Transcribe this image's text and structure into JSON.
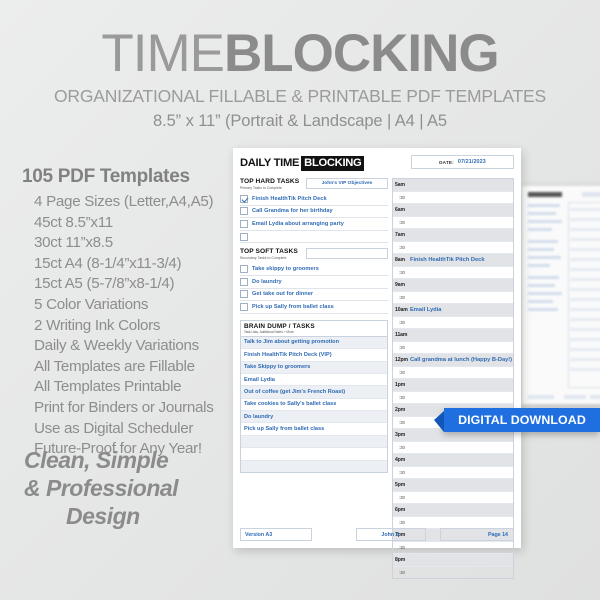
{
  "header": {
    "title_light": "TIME",
    "title_bold": "BLOCKING",
    "subtitle": "ORGANIZATIONAL FILLABLE & PRINTABLE PDF TEMPLATES",
    "subtitle2": "8.5” x 11” (Portrait & Landscape  |  A4  |  A5"
  },
  "features": {
    "title": "105 PDF Templates",
    "items": [
      "4 Page Sizes (Letter,A4,A5)",
      "45ct 8.5”x11",
      "30ct 11”x8.5",
      "15ct A4 (8-1/4”x11-3/4)",
      "15ct A5 (5-7/8”x8-1/4)",
      "5 Color Variations",
      "2 Writing Ink Colors",
      "Daily & Weekly Variations",
      "All Templates are Fillable",
      "All Templates Printable",
      "Print for Binders or Journals",
      "Use as Digital Scheduler",
      "Future-Proof for Any Year!"
    ],
    "tagline_line1": "Clean, Simple",
    "tagline_line2": "& Professional",
    "tagline_line3": "Design"
  },
  "ribbon": {
    "label": "DIGITAL DOWNLOAD"
  },
  "document": {
    "title_plain": "DAILY TIME",
    "title_inverse": "BLOCKING",
    "date_label": "DATE:",
    "date_value": "07/21/2023",
    "hard_tasks": {
      "heading": "TOP HARD TASKS",
      "subheading": "Primary Tasks to Complete",
      "field_value": "John's VIP Objectives",
      "items": [
        {
          "text": "Finish HealthTik Pitch Deck",
          "checked": true
        },
        {
          "text": "Call Grandma for her birthday",
          "checked": false
        },
        {
          "text": "Email Lydia about arranging party",
          "checked": false
        },
        {
          "text": "",
          "checked": false
        }
      ]
    },
    "soft_tasks": {
      "heading": "TOP SOFT TASKS",
      "subheading": "Secondary Tasks to Complete",
      "field_value": "",
      "items": [
        {
          "text": "Take skippy to groomers",
          "checked": false
        },
        {
          "text": "Do laundry",
          "checked": false
        },
        {
          "text": "Get take out for dinner",
          "checked": false
        },
        {
          "text": "Pick up Sally from ballet class",
          "checked": false
        }
      ]
    },
    "brain_dump": {
      "heading": "BRAIN DUMP / TASKS",
      "subheading": "Task Lists, Additional Notes + More",
      "items": [
        "Talk to Jim about getting promotion",
        "Finish HealthTik Pitch Deck (VIP)",
        "Take Skippy to groomers",
        "Email Lydia",
        "Out of coffee (get Jim's French Roast)",
        "Take cookies to Sally's ballet class",
        "Do laundry",
        "Pick up Sally from ballet class",
        "",
        "",
        ""
      ]
    },
    "schedule": {
      "half_label": ":30",
      "rows": [
        {
          "time": "5am",
          "entry": ""
        },
        {
          "time": "6am",
          "entry": ""
        },
        {
          "time": "7am",
          "entry": ""
        },
        {
          "time": "8am",
          "entry": "Finish HealthTik Pitch Deck"
        },
        {
          "time": "9am",
          "entry": ""
        },
        {
          "time": "10am",
          "entry": "Email Lydia"
        },
        {
          "time": "11am",
          "entry": ""
        },
        {
          "time": "12pm",
          "entry": "Call grandma at lunch (Happy B-Day!)"
        },
        {
          "time": "1pm",
          "entry": ""
        },
        {
          "time": "2pm",
          "entry": ""
        },
        {
          "time": "3pm",
          "entry": ""
        },
        {
          "time": "4pm",
          "entry": ""
        },
        {
          "time": "5pm",
          "entry": ""
        },
        {
          "time": "6pm",
          "entry": ""
        },
        {
          "time": "7pm",
          "entry": ""
        },
        {
          "time": "8pm",
          "entry": ""
        }
      ]
    },
    "footer": {
      "version": "Version A3",
      "user": "John S.",
      "page": "Page  14"
    }
  },
  "colors": {
    "accent_blue": "#2f6bb5",
    "ribbon_blue": "#1f6fe0",
    "text_grey": "#8d8d8d",
    "row_grey": "#e1e3e6"
  }
}
